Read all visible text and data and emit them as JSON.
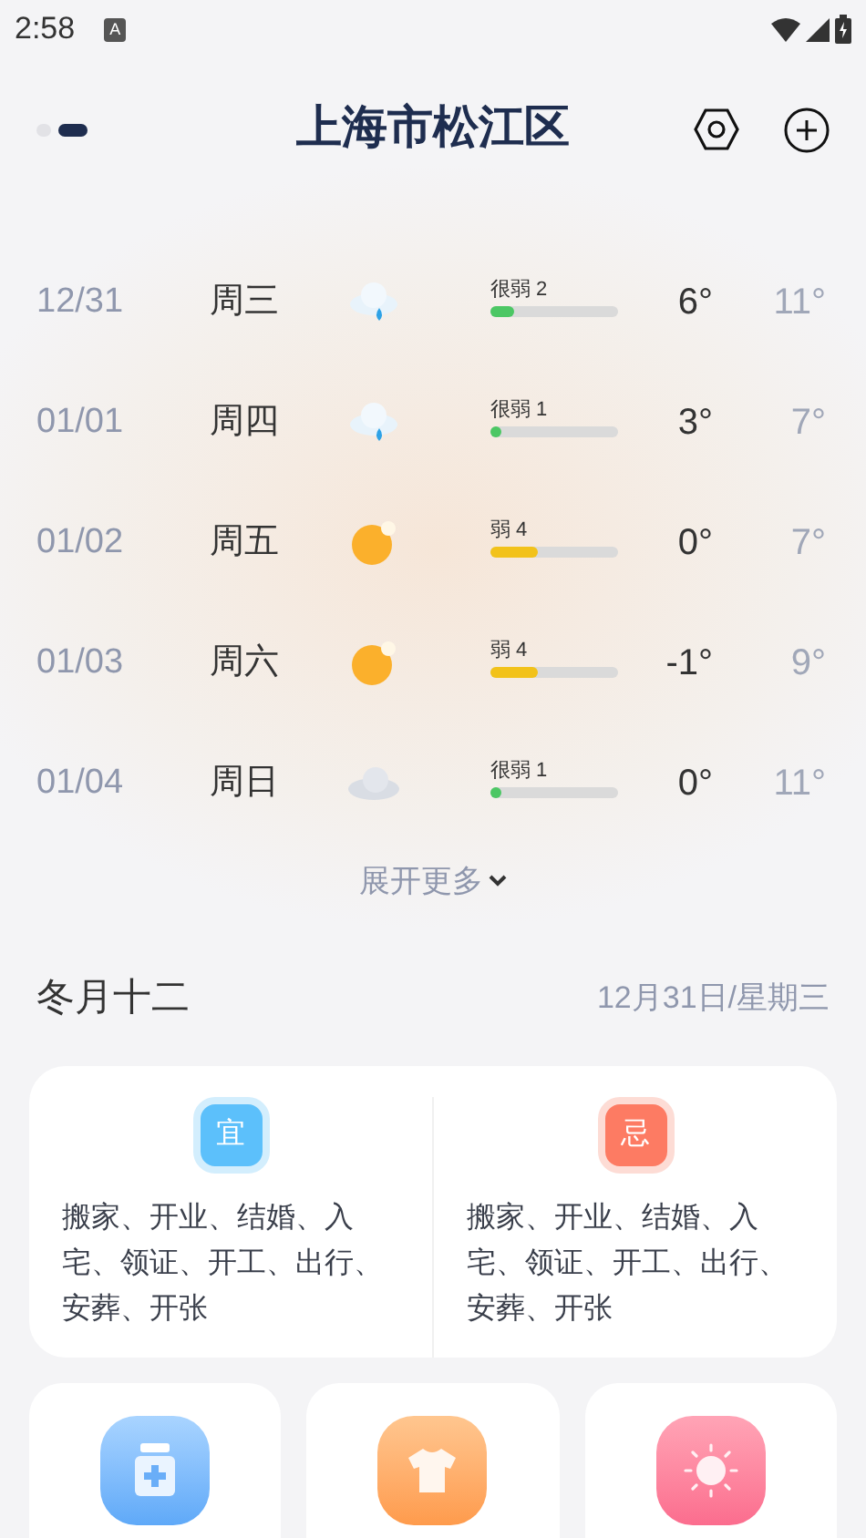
{
  "status_bar": {
    "time": "2:58",
    "badge": "A"
  },
  "header": {
    "title": "上海市松江区",
    "pages": [
      {
        "selected": false
      },
      {
        "selected": true
      }
    ]
  },
  "forecast": [
    {
      "date": "12/31",
      "weekday": "周三",
      "kind": "rain",
      "aqi": "很弱 2",
      "level": 0.19,
      "color": "#4cc764",
      "low": "6°",
      "high": "11°"
    },
    {
      "date": "01/01",
      "weekday": "周四",
      "kind": "rain",
      "aqi": "很弱 1",
      "level": 0.05,
      "color": "#4cc764",
      "low": "3°",
      "high": "7°"
    },
    {
      "date": "01/02",
      "weekday": "周五",
      "kind": "sun",
      "aqi": "弱 4",
      "level": 0.37,
      "color": "#f2c21a",
      "low": "0°",
      "high": "7°"
    },
    {
      "date": "01/03",
      "weekday": "周六",
      "kind": "sun",
      "aqi": "弱 4",
      "level": 0.37,
      "color": "#f2c21a",
      "low": "-1°",
      "high": "9°"
    },
    {
      "date": "01/04",
      "weekday": "周日",
      "kind": "cloud",
      "aqi": "很弱 1",
      "level": 0.05,
      "color": "#4cc764",
      "low": "0°",
      "high": "11°"
    }
  ],
  "expand_more": "展开更多",
  "almanac": {
    "lunar_date": "冬月十二",
    "date": "12月31日/星期三",
    "columns": [
      {
        "kind": "good",
        "badge": "宜",
        "text": "搬家、开业、结婚、入宅、领证、开工、出行、安葬、开张"
      },
      {
        "kind": "bad",
        "badge": "忌",
        "text": "搬家、开业、结婚、入宅、领证、开工、出行、安葬、开张"
      }
    ]
  },
  "tiles": [
    {
      "kind": "medicine"
    },
    {
      "kind": "shirt"
    },
    {
      "kind": "sun"
    }
  ]
}
